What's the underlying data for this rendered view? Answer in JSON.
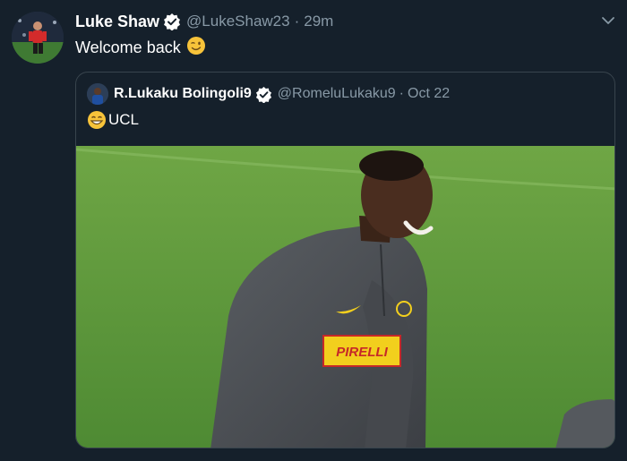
{
  "tweet": {
    "author_name": "Luke Shaw",
    "author_handle": "@LukeShaw23",
    "separator": "·",
    "time": "29m",
    "text": "Welcome back",
    "emoji": "wink-face"
  },
  "quoted": {
    "author_name": "R.Lukaku Bolingoli9",
    "author_handle": "@RomeluLukaku9",
    "separator": "·",
    "date": "Oct 22",
    "text": "UCL",
    "emoji": "grinning-face",
    "photo": {
      "shirt_sponsor": "PIRELLI",
      "colors": {
        "pitch": "#5f9a3c",
        "kit": "#4c4f54",
        "sponsor_yellow": "#f2cf1d"
      }
    }
  },
  "colors": {
    "background": "#15202b",
    "muted": "#8899a6",
    "border": "#38444d",
    "verified": "#ffffff"
  }
}
